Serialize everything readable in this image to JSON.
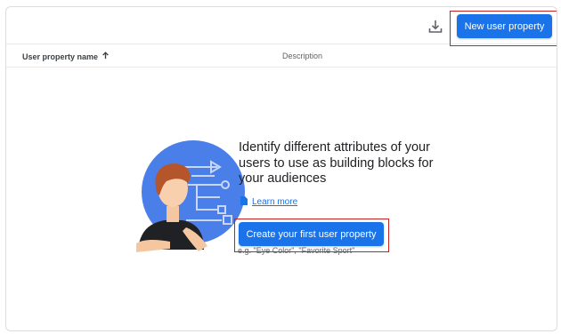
{
  "toolbar": {
    "new_button_label": "New user property",
    "download_icon": "download-icon"
  },
  "table": {
    "columns": [
      {
        "label": "User property name",
        "sort": "ascending"
      },
      {
        "label": "Description"
      }
    ]
  },
  "empty_state": {
    "message": "Identify different attributes of your users to use as building blocks for your audiences",
    "learn_more": "Learn more",
    "create_button_label": "Create your first user property",
    "example_text": "e.g. \"Eye Color\", \"Favorite Sport\""
  },
  "colors": {
    "accent": "#1a73e8",
    "highlight_border": "#c5221f",
    "illustration_circle": "#4a7ee8"
  }
}
